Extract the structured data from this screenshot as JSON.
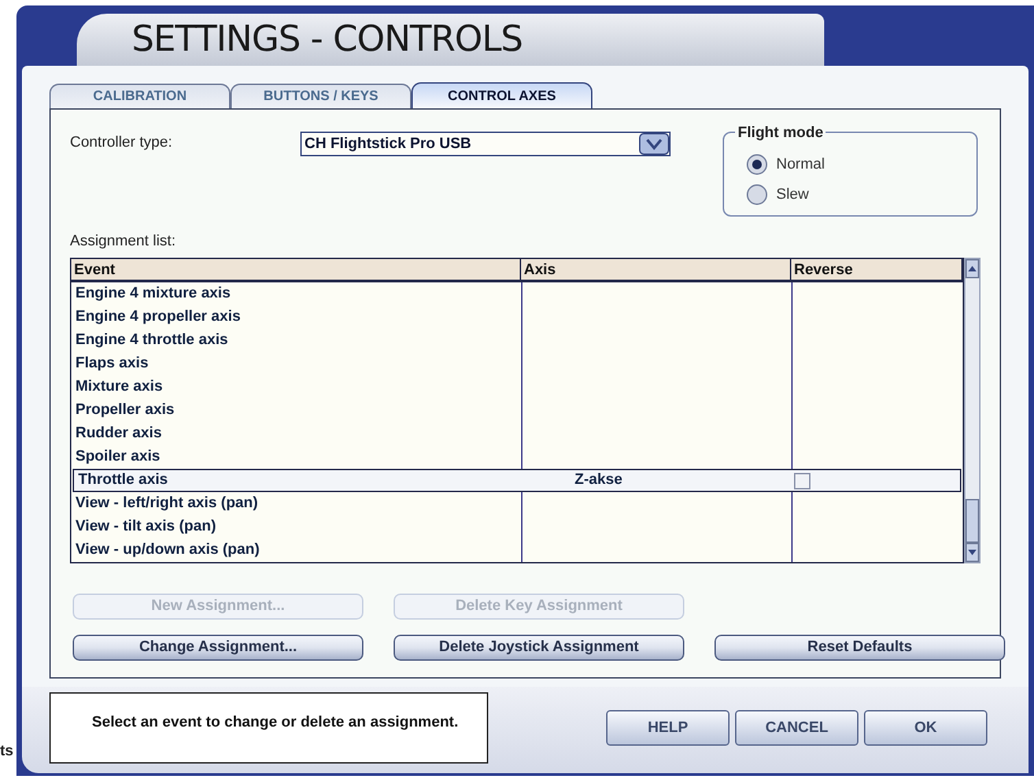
{
  "window": {
    "title": "SETTINGS - CONTROLS"
  },
  "tabs": [
    {
      "label": "CALIBRATION",
      "selected": false
    },
    {
      "label": "BUTTONS / KEYS",
      "selected": false
    },
    {
      "label": "CONTROL AXES",
      "selected": true
    }
  ],
  "controller_type": {
    "label": "Controller type:",
    "value": "CH Flightstick Pro USB"
  },
  "flight_mode": {
    "title": "Flight mode",
    "options": [
      {
        "label": "Normal",
        "selected": true
      },
      {
        "label": "Slew",
        "selected": false
      }
    ]
  },
  "assignment_list": {
    "label": "Assignment list:",
    "columns": [
      "Event",
      "Axis",
      "Reverse"
    ],
    "rows": [
      {
        "event": "Engine 4 mixture axis",
        "selected": false
      },
      {
        "event": "Engine 4 propeller axis",
        "selected": false
      },
      {
        "event": "Engine 4 throttle axis",
        "selected": false
      },
      {
        "event": "Flaps axis",
        "selected": false
      },
      {
        "event": "Mixture axis",
        "selected": false
      },
      {
        "event": "Propeller axis",
        "selected": false
      },
      {
        "event": "Rudder axis",
        "selected": false
      },
      {
        "event": "Spoiler axis",
        "selected": false
      },
      {
        "event": "Throttle axis",
        "axis": "Z-akse",
        "reverse": false,
        "selected": true
      },
      {
        "event": "View - left/right axis (pan)",
        "selected": false
      },
      {
        "event": "View - tilt axis (pan)",
        "selected": false
      },
      {
        "event": "View - up/down axis (pan)",
        "selected": false
      }
    ]
  },
  "actions": [
    {
      "label": "New Assignment...",
      "disabled": true
    },
    {
      "label": "Delete Key Assignment",
      "disabled": true
    },
    {
      "label": "Change Assignment...",
      "disabled": false
    },
    {
      "label": "Delete Joystick Assignment",
      "disabled": false
    },
    {
      "label": "Reset Defaults",
      "disabled": false
    }
  ],
  "status": "Select an event to change or delete an assignment.",
  "dialog_buttons": [
    "HELP",
    "CANCEL",
    "OK"
  ],
  "background_text": "ts"
}
